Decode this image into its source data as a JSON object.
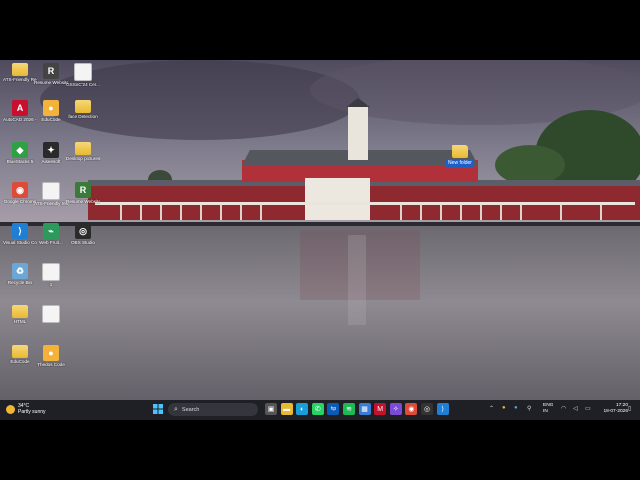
{
  "desktop": {
    "icons": [
      {
        "label": "ATS-Friendly Resume Fo...",
        "kind": "folder",
        "glyph": ""
      },
      {
        "label": "Resume Website",
        "kind": "app",
        "glyph": "R",
        "color": "#444"
      },
      {
        "label": "GSSoC'24 Cer...",
        "kind": "doc",
        "glyph": ""
      },
      {
        "label": "AutoCAD 2026 - ...",
        "kind": "app",
        "glyph": "A",
        "color": "#c8102e"
      },
      {
        "label": "EduCode",
        "kind": "app",
        "glyph": "●",
        "color": "#f3b23a"
      },
      {
        "label": "face Detection",
        "kind": "folder",
        "glyph": ""
      },
      {
        "label": "BlueStacks 5",
        "kind": "app",
        "glyph": "◆",
        "color": "#2fa043"
      },
      {
        "label": "Aiseesoft",
        "kind": "app",
        "glyph": "✦",
        "color": "#2a2a2a"
      },
      {
        "label": "Desktop pictures",
        "kind": "folder",
        "glyph": ""
      },
      {
        "label": "Google Chrome",
        "kind": "app",
        "glyph": "◉",
        "color": "#dd4b39"
      },
      {
        "label": "ATS-Friendly resume fo...",
        "kind": "doc",
        "glyph": ""
      },
      {
        "label": "Resume Website",
        "kind": "app",
        "glyph": "R",
        "color": "#3b7a3b"
      },
      {
        "label": "Visual Studio Code",
        "kind": "app",
        "glyph": "⟩",
        "color": "#1f7fd4"
      },
      {
        "label": "Web Fruit...",
        "kind": "app",
        "glyph": "⌁",
        "color": "#2b9a5a"
      },
      {
        "label": "OBS Studio",
        "kind": "app",
        "glyph": "◎",
        "color": "#2b2b2b"
      },
      {
        "label": "Recycle Bin",
        "kind": "app",
        "glyph": "♻",
        "color": "#6aa6d6"
      },
      {
        "label": "1",
        "kind": "doc",
        "glyph": ""
      },
      {
        "label": "HTML",
        "kind": "folder",
        "glyph": ""
      },
      {
        "label": "",
        "kind": "doc",
        "glyph": ""
      },
      {
        "label": "EduCode",
        "kind": "folder",
        "glyph": ""
      },
      {
        "label": "Thedos Code",
        "kind": "app",
        "glyph": "●",
        "color": "#f3b23a"
      }
    ],
    "new_folder_label": "New folder"
  },
  "taskbar": {
    "weather_temp": "34°C",
    "weather_desc": "Partly sunny",
    "search_placeholder": "Search",
    "language": "ENG",
    "region": "IN",
    "time": "17:20",
    "date": "18-07-2026",
    "pinned": [
      {
        "name": "task-view",
        "glyph": "▣",
        "color": "#555"
      },
      {
        "name": "file-explorer",
        "glyph": "▬",
        "color": "#e8b932"
      },
      {
        "name": "edge",
        "glyph": "◐",
        "color": "#1a9ed8"
      },
      {
        "name": "whatsapp",
        "glyph": "✆",
        "color": "#25d366"
      },
      {
        "name": "hp",
        "glyph": "hp",
        "color": "#0a5bb5"
      },
      {
        "name": "spotify",
        "glyph": "≋",
        "color": "#1db954"
      },
      {
        "name": "photos",
        "glyph": "▦",
        "color": "#3a7bd5"
      },
      {
        "name": "mcafee",
        "glyph": "M",
        "color": "#c8102e"
      },
      {
        "name": "copilot",
        "glyph": "✧",
        "color": "#7b4bd8"
      },
      {
        "name": "chrome",
        "glyph": "◉",
        "color": "#dd4b39"
      },
      {
        "name": "obs",
        "glyph": "◎",
        "color": "#333"
      },
      {
        "name": "vscode",
        "glyph": "⟩",
        "color": "#1f7fd4"
      }
    ]
  }
}
